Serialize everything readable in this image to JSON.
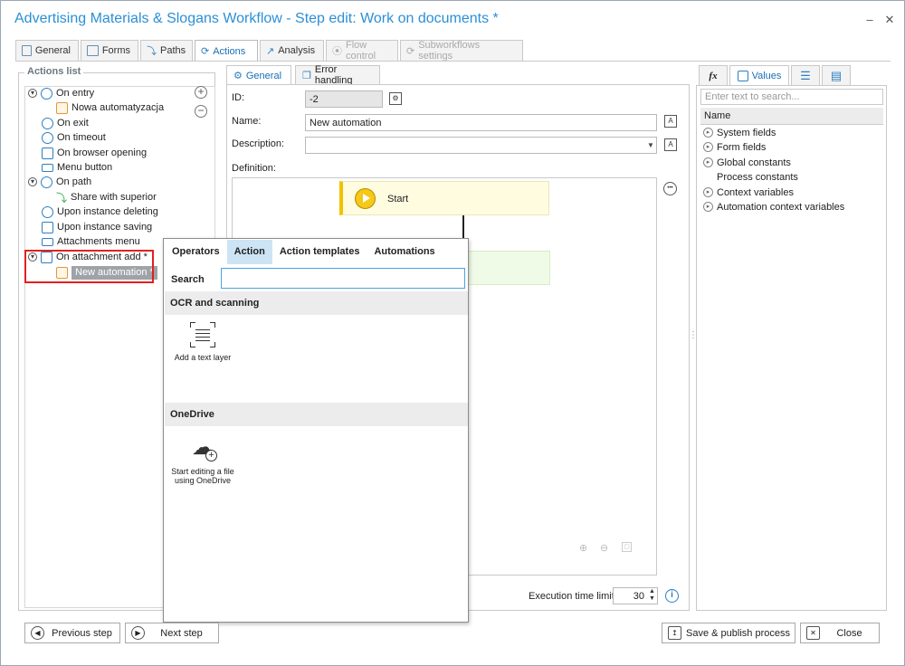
{
  "window": {
    "title": "Advertising Materials & Slogans Workflow - Step edit: Work on documents *",
    "minimize": "–",
    "close": "✕"
  },
  "top_tabs": [
    {
      "label": "General"
    },
    {
      "label": "Forms"
    },
    {
      "label": "Paths"
    },
    {
      "label": "Actions"
    },
    {
      "label": "Analysis"
    },
    {
      "label": "Flow control"
    },
    {
      "label": "Subworkflows settings"
    }
  ],
  "actions_list": {
    "title": "Actions list",
    "items": [
      {
        "label": "On entry",
        "icon": "arrow-right-circle-icon"
      },
      {
        "label": "Nowa automatyzacja",
        "icon": "automation-icon"
      },
      {
        "label": "On exit",
        "icon": "exit-icon"
      },
      {
        "label": "On timeout",
        "icon": "clock-icon"
      },
      {
        "label": "On browser opening",
        "icon": "browser-icon"
      },
      {
        "label": "Menu button",
        "icon": "menu-button-icon"
      },
      {
        "label": "On path",
        "icon": "path-icon"
      },
      {
        "label": "Share with superior",
        "icon": "share-icon"
      },
      {
        "label": "Upon instance deleting",
        "icon": "delete-circle-icon"
      },
      {
        "label": "Upon instance saving",
        "icon": "save-icon"
      },
      {
        "label": "Attachments menu",
        "icon": "attachment-menu-icon"
      },
      {
        "label": "On attachment add *",
        "icon": "attachment-add-icon"
      },
      {
        "label": "New automation *",
        "icon": "automation-icon"
      }
    ],
    "add": "+",
    "remove": "−"
  },
  "middle_tabs": [
    {
      "label": "General"
    },
    {
      "label": "Error handling"
    }
  ],
  "form": {
    "id_label": "ID:",
    "id_value": "-2",
    "name_label": "Name:",
    "name_value": "New automation",
    "description_label": "Description:",
    "description_value": "",
    "definition_label": "Definition:"
  },
  "canvas": {
    "start_node": "Start",
    "more": "•••"
  },
  "exec": {
    "label": "Execution time limit:",
    "value": "30",
    "info": "i"
  },
  "right_panel": {
    "tabs": [
      {
        "label": "fx"
      },
      {
        "label": "Values"
      },
      {
        "label": ""
      },
      {
        "label": ""
      }
    ],
    "search_placeholder": "Enter text to search...",
    "column": "Name",
    "items": [
      {
        "label": "System fields",
        "expandable": true
      },
      {
        "label": "Form fields",
        "expandable": true
      },
      {
        "label": "Global constants",
        "expandable": true
      },
      {
        "label": "Process constants",
        "expandable": false
      },
      {
        "label": "Context variables",
        "expandable": true
      },
      {
        "label": "Automation context variables",
        "expandable": true
      }
    ]
  },
  "popup": {
    "tabs": [
      {
        "label": "Operators"
      },
      {
        "label": "Action"
      },
      {
        "label": "Action templates"
      },
      {
        "label": "Automations"
      }
    ],
    "search_label": "Search",
    "search_value": "",
    "sections": [
      {
        "title": "OCR and scanning",
        "action": "Add a text layer"
      },
      {
        "title": "OneDrive",
        "action": "Start editing a file using OneDrive"
      }
    ]
  },
  "bottom": {
    "previous": "Previous step",
    "next": "Next step",
    "save_publish": "Save & publish process",
    "close": "Close"
  }
}
